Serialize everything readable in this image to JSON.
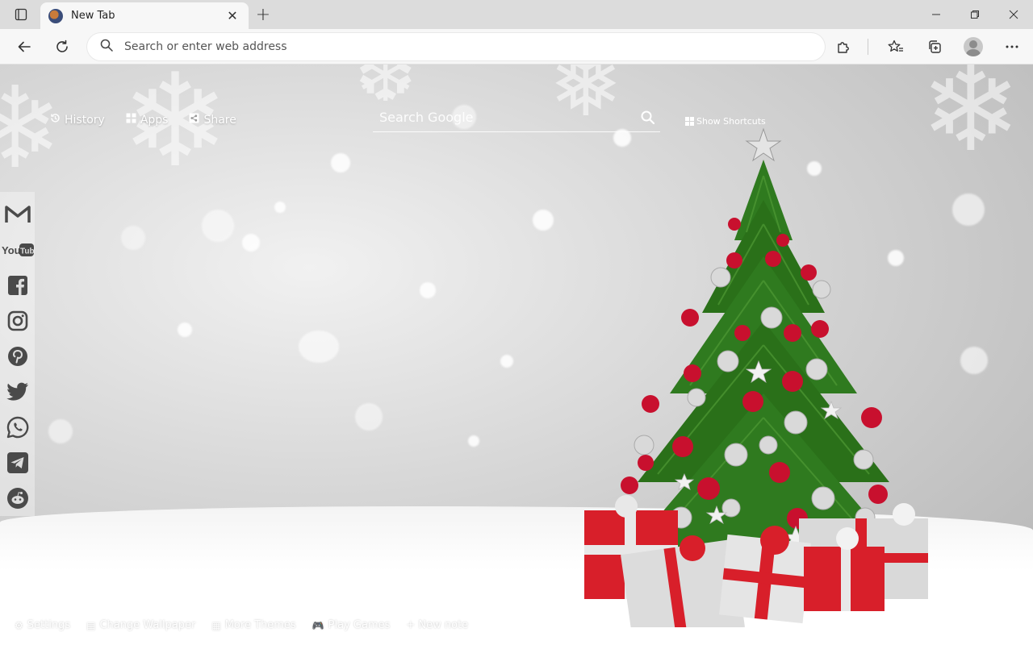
{
  "browser": {
    "tab": {
      "title": "New Tab"
    },
    "address_bar": {
      "placeholder": "Search or enter web address"
    }
  },
  "page": {
    "top_links": [
      {
        "label": "History",
        "icon": "history-icon"
      },
      {
        "label": "Apps",
        "icon": "apps-grid-icon"
      },
      {
        "label": "Share",
        "icon": "share-icon"
      }
    ],
    "search": {
      "placeholder": "Search Google"
    },
    "show_shortcuts_label": "Show Shortcuts",
    "social_shortcuts": [
      {
        "name": "gmail-icon",
        "glyph": "M"
      },
      {
        "name": "youtube-icon",
        "glyph": "YouTube"
      },
      {
        "name": "facebook-icon",
        "glyph": "f"
      },
      {
        "name": "instagram-icon",
        "glyph": "◎"
      },
      {
        "name": "pinterest-icon",
        "glyph": "P"
      },
      {
        "name": "twitter-icon",
        "glyph": "🐦"
      },
      {
        "name": "whatsapp-icon",
        "glyph": "✆"
      },
      {
        "name": "telegram-icon",
        "glyph": "➤"
      },
      {
        "name": "reddit-icon",
        "glyph": "●"
      }
    ],
    "bottom_links": [
      {
        "label": "Settings",
        "icon": "gear-icon"
      },
      {
        "label": "Change Wallpaper",
        "icon": "image-icon"
      },
      {
        "label": "More Themes",
        "icon": "grid-icon"
      },
      {
        "label": "Play Games",
        "icon": "gamepad-icon"
      },
      {
        "label": "+ New note",
        "icon": ""
      }
    ]
  },
  "colors": {
    "tree_green": "#2f7a1f",
    "ornament_red": "#c8102e",
    "ornament_silver": "#d9d9d9",
    "gift_red": "#d81f2a"
  }
}
